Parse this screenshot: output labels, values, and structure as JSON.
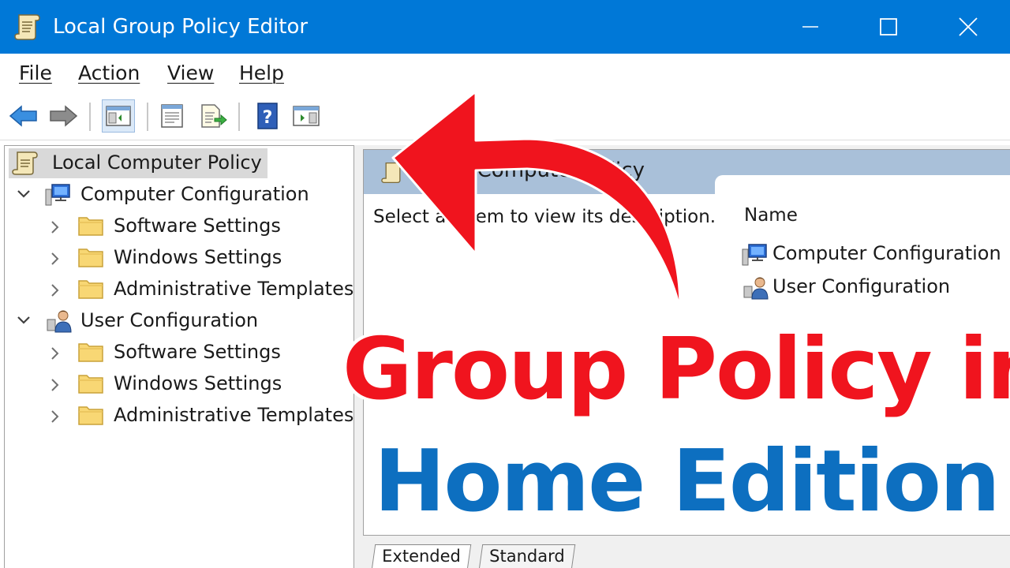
{
  "window": {
    "title": "Local Group Policy Editor",
    "controls": {
      "minimize": "minimize",
      "maximize": "maximize",
      "close": "close"
    }
  },
  "menu": {
    "items": [
      {
        "label": "File"
      },
      {
        "label": "Action"
      },
      {
        "label": "View"
      },
      {
        "label": "Help"
      }
    ]
  },
  "toolbar": {
    "buttons": [
      "back-icon",
      "forward-icon",
      "show-hide-console-tree-icon",
      "properties-icon",
      "export-list-icon",
      "help-icon",
      "show-action-pane-icon"
    ]
  },
  "tree": {
    "root": "Local Computer Policy",
    "nodes": [
      {
        "label": "Computer Configuration",
        "icon": "computer-icon",
        "children": [
          "Software Settings",
          "Windows Settings",
          "Administrative Templates"
        ]
      },
      {
        "label": "User Configuration",
        "icon": "user-icon",
        "children": [
          "Software Settings",
          "Windows Settings",
          "Administrative Templates"
        ]
      }
    ]
  },
  "detail": {
    "header_title": "Local Computer Policy",
    "description": "Select an item to view its description.",
    "column_name": "Name",
    "items": [
      "Computer Configuration",
      "User Configuration"
    ],
    "tabs": [
      "Extended",
      "Standard"
    ]
  },
  "overlay": {
    "line1": "Group Policy in",
    "line2": "Home Edition",
    "colors": {
      "line1": "#f0141e",
      "line2": "#0d6fc0",
      "arrow": "#f0141e"
    }
  },
  "colors": {
    "titlebar": "#0078d7",
    "detail_header": "#a9c0d9",
    "selection": "#d9d9d9"
  }
}
